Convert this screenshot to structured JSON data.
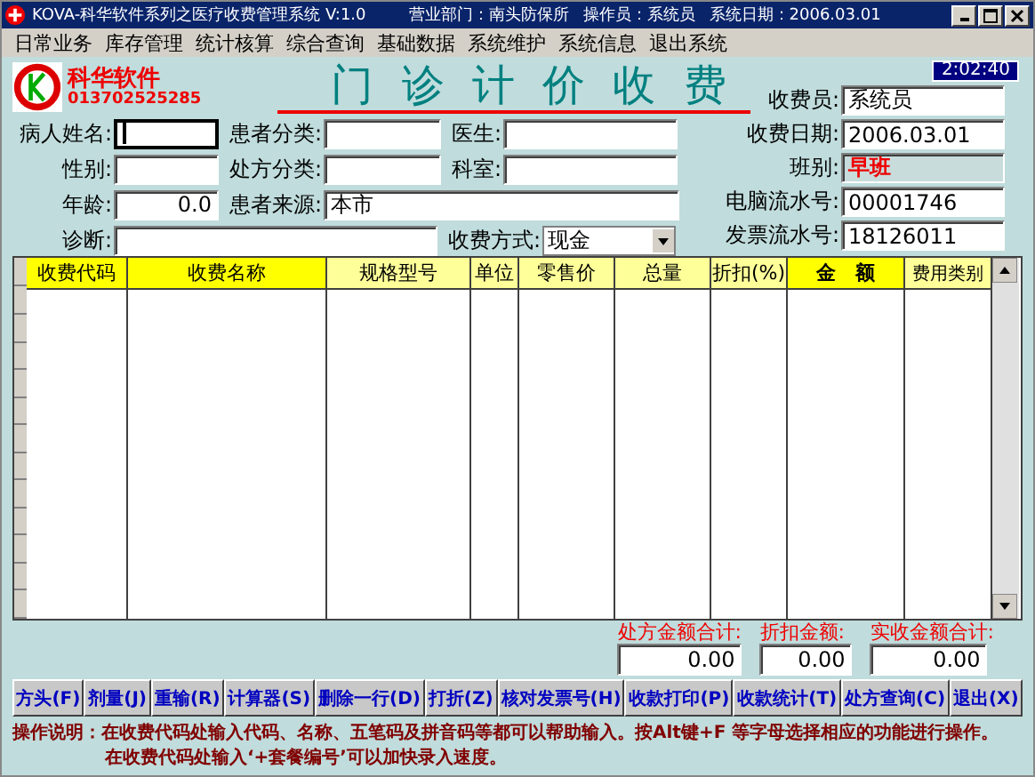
{
  "window": {
    "title": "KOVA-科华软件系列之医疗收费管理系统 V:1.0",
    "department": "营业部门：南头防保所",
    "operator": "操作员：系统员",
    "system_date": "系统日期：2006.03.01"
  },
  "menu": [
    "日常业务",
    "库存管理",
    "统计核算",
    "综合查询",
    "基础数据",
    "系统维护",
    "系统信息",
    "退出系统"
  ],
  "header": {
    "logo_text": "科华软件",
    "phone": "013702525285",
    "title": "门 诊 计 价 收 费",
    "clock": "2:02:40"
  },
  "patient_rows": [
    {
      "fields": [
        {
          "label": "病人姓名:",
          "focused": true
        },
        {
          "label": "患者分类:",
          "focused": false
        },
        {
          "label": "医生:",
          "focused": false
        }
      ]
    },
    {
      "fields": [
        {
          "label": "性别:",
          "focused": false
        },
        {
          "label": "处方分类:",
          "focused": false
        },
        {
          "label": "科室:",
          "focused": false
        }
      ]
    },
    {
      "fields": [
        {
          "label": "年龄:",
          "value": "0.0",
          "focused": false
        },
        {
          "label": "患者来源:",
          "value": "本市",
          "focused": false
        }
      ]
    },
    {
      "fields": [
        {
          "label": "诊断:",
          "focused": false
        }
      ],
      "payment": {
        "label": "收费方式:",
        "value": "现金"
      }
    }
  ],
  "cashier_fields": [
    {
      "label": "收费员:",
      "value": "系统员",
      "kind": "field"
    },
    {
      "label": "收费日期:",
      "value": "2006.03.01",
      "kind": "field"
    },
    {
      "label": "班别:",
      "value": "早班",
      "kind": "shift"
    },
    {
      "label": "电脑流水号:",
      "value": "00001746",
      "kind": "field"
    },
    {
      "label": "发票流水号:",
      "value": "18126011",
      "kind": "field"
    }
  ],
  "table": {
    "columns": [
      {
        "label": "收费代码",
        "color": "#ffff00",
        "bold": false
      },
      {
        "label": "收费名称",
        "color": "#ffff00",
        "bold": false
      },
      {
        "label": "规格型号",
        "color": "#ffff99",
        "bold": false
      },
      {
        "label": "单位",
        "color": "#ffff99",
        "bold": false
      },
      {
        "label": "零售价",
        "color": "#ffff99",
        "bold": false
      },
      {
        "label": "总量",
        "color": "#ffff99",
        "bold": false
      },
      {
        "label": "折扣(%)",
        "color": "#ffff99",
        "bold": false
      },
      {
        "label": "金　额",
        "color": "#ffff00",
        "bold": true
      },
      {
        "label": "费用类别",
        "color": "#ffff99",
        "bold": false
      }
    ]
  },
  "totals": [
    {
      "label": "处方金额合计:",
      "value": "0.00"
    },
    {
      "label": "折扣金额:",
      "value": "0.00"
    },
    {
      "label": "实收金额合计:",
      "value": "0.00"
    }
  ],
  "buttons": [
    "方头(F)",
    "剂量(J)",
    "重输(R)",
    "计算器(S)",
    "删除一行(D)",
    "打折(Z)",
    "核对发票号(H)",
    "收款打印(P)",
    "收款统计(T)",
    "处方查询(C)",
    "退出(X)"
  ],
  "notes": {
    "label": "操作说明：",
    "lines": [
      "在收费代码处输入代码、名称、五笔码及拼音码等都可以帮助输入。按Alt键+F 等字母选择相应的功能进行操作。",
      "在收费代码处输入‘+套餐编号’可以加快录入速度。"
    ]
  }
}
